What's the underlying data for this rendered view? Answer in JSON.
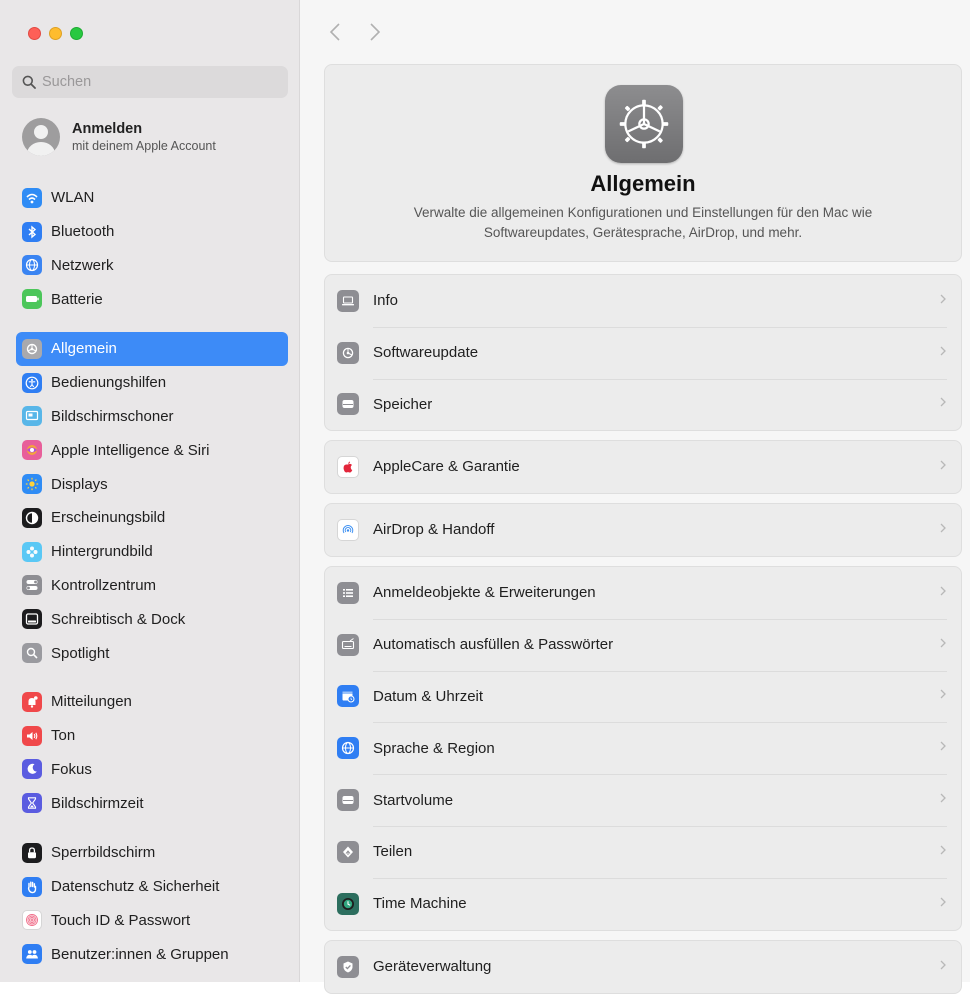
{
  "search": {
    "placeholder": "Suchen"
  },
  "account": {
    "name": "Anmelden",
    "subtitle": "mit deinem Apple Account"
  },
  "sidebar": {
    "group1": [
      {
        "label": "WLAN",
        "icon": "wifi-icon",
        "color": "#2f8cf5"
      },
      {
        "label": "Bluetooth",
        "icon": "bluetooth-icon",
        "color": "#2f7ef3"
      },
      {
        "label": "Netzwerk",
        "icon": "globe-icon",
        "color": "#3a84f2"
      },
      {
        "label": "Batterie",
        "icon": "battery-icon",
        "color": "#4cc65a"
      }
    ],
    "group2": [
      {
        "label": "Allgemein",
        "icon": "gear-icon",
        "color": "#8e8e93",
        "selected": true
      },
      {
        "label": "Bedienungshilfen",
        "icon": "accessibility-icon",
        "color": "#2f7ef3"
      },
      {
        "label": "Bildschirmschoner",
        "icon": "screensaver-icon",
        "color": "#58b6e8"
      },
      {
        "label": "Apple Intelligence & Siri",
        "icon": "siri-icon",
        "color": "#e85f9a"
      },
      {
        "label": "Displays",
        "icon": "sun-icon",
        "color": "#2f8cf5"
      },
      {
        "label": "Erscheinungsbild",
        "icon": "appearance-icon",
        "color": "#1c1c1e"
      },
      {
        "label": "Hintergrundbild",
        "icon": "flower-icon",
        "color": "#5ac8f5"
      },
      {
        "label": "Kontrollzentrum",
        "icon": "toggles-icon",
        "color": "#8e8e93"
      },
      {
        "label": "Schreibtisch & Dock",
        "icon": "dock-icon",
        "color": "#1c1c1e"
      },
      {
        "label": "Spotlight",
        "icon": "magnifier-icon",
        "color": "#9a9a9f"
      }
    ],
    "group3": [
      {
        "label": "Mitteilungen",
        "icon": "bell-icon",
        "color": "#f0484a"
      },
      {
        "label": "Ton",
        "icon": "speaker-icon",
        "color": "#f0484a"
      },
      {
        "label": "Fokus",
        "icon": "moon-icon",
        "color": "#5b5ce0"
      },
      {
        "label": "Bildschirmzeit",
        "icon": "hourglass-icon",
        "color": "#5b5ce0"
      }
    ],
    "group4": [
      {
        "label": "Sperrbildschirm",
        "icon": "lock-icon",
        "color": "#1c1c1e"
      },
      {
        "label": "Datenschutz & Sicherheit",
        "icon": "hand-icon",
        "color": "#2f7ef3"
      },
      {
        "label": "Touch ID & Passwort",
        "icon": "fingerprint-icon",
        "color": "#ffffff"
      },
      {
        "label": "Benutzer:innen & Gruppen",
        "icon": "users-icon",
        "color": "#2f7ef3"
      }
    ]
  },
  "hero": {
    "title": "Allgemein",
    "description": "Verwalte die allgemeinen Konfigurationen und Einstellungen für den Mac wie Softwareupdates, Gerätesprache, AirDrop, und mehr."
  },
  "main": {
    "group1": [
      {
        "label": "Info",
        "icon": "laptop-icon",
        "color": "#8e8e93"
      },
      {
        "label": "Softwareupdate",
        "icon": "gear-badge-icon",
        "color": "#8e8e93"
      },
      {
        "label": "Speicher",
        "icon": "drive-icon",
        "color": "#8e8e93"
      }
    ],
    "group2": [
      {
        "label": "AppleCare & Garantie",
        "icon": "apple-icon",
        "color": "#ffffff"
      }
    ],
    "group3": [
      {
        "label": "AirDrop & Handoff",
        "icon": "airdrop-icon",
        "color": "#ffffff"
      }
    ],
    "group4": [
      {
        "label": "Anmeldeobjekte & Erweiterungen",
        "icon": "list-icon",
        "color": "#8e8e93"
      },
      {
        "label": "Automatisch ausfüllen & Passwörter",
        "icon": "keyboard-icon",
        "color": "#8e8e93"
      },
      {
        "label": "Datum & Uhrzeit",
        "icon": "calendar-clock-icon",
        "color": "#2f7ef3"
      },
      {
        "label": "Sprache & Region",
        "icon": "globe-icon",
        "color": "#2f7ef3"
      },
      {
        "label": "Startvolume",
        "icon": "drive-icon",
        "color": "#8e8e93"
      },
      {
        "label": "Teilen",
        "icon": "share-icon",
        "color": "#8e8e93"
      },
      {
        "label": "Time Machine",
        "icon": "timemachine-icon",
        "color": "#2c6e5e"
      }
    ],
    "group5": [
      {
        "label": "Geräteverwaltung",
        "icon": "checkmark-badge-icon",
        "color": "#8e8e93"
      }
    ]
  }
}
